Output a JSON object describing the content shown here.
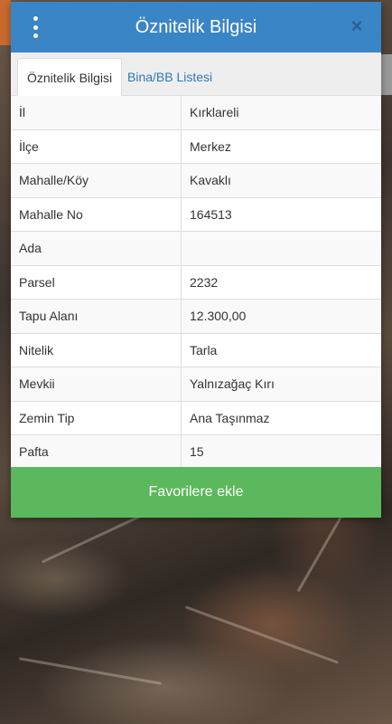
{
  "modal": {
    "title": "Öznitelik Bilgisi",
    "close_icon": "×",
    "menu_icon": "more-vertical-icon"
  },
  "tabs": [
    {
      "label": "Öznitelik Bilgisi",
      "active": true
    },
    {
      "label": "Bina/BB Listesi",
      "active": false
    }
  ],
  "attributes": [
    {
      "key": "İl",
      "value": "Kırklareli"
    },
    {
      "key": "İlçe",
      "value": "Merkez"
    },
    {
      "key": "Mahalle/Köy",
      "value": "Kavaklı"
    },
    {
      "key": "Mahalle No",
      "value": "164513"
    },
    {
      "key": "Ada",
      "value": ""
    },
    {
      "key": "Parsel",
      "value": "2232"
    },
    {
      "key": "Tapu Alanı",
      "value": "12.300,00"
    },
    {
      "key": "Nitelik",
      "value": "Tarla"
    },
    {
      "key": "Mevkii",
      "value": "Yalnızağaç Kırı"
    },
    {
      "key": "Zemin Tip",
      "value": "Ana Taşınmaz"
    },
    {
      "key": "Pafta",
      "value": "15"
    }
  ],
  "footer": {
    "favorite_label": "Favorilere ekle"
  },
  "colors": {
    "header": "#3a85c6",
    "favorite_button": "#5cb85c",
    "tab_link": "#2f78b5"
  }
}
